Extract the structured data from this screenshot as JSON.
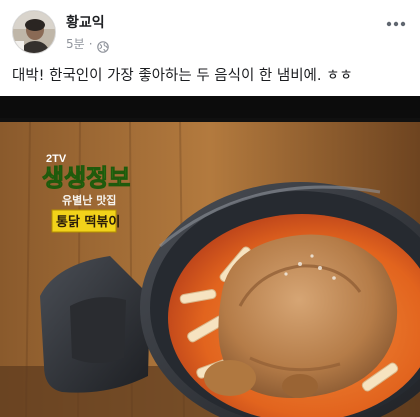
{
  "post": {
    "author": "황교익",
    "timestamp": "5분",
    "separator": "·",
    "text": "대박! 한국인이 가장 좋아하는 두 음식이 한 냄비에. ㅎㅎ"
  },
  "photo": {
    "channel": "2TV",
    "show_title": "생생정보",
    "subtitle": "유별난 맛집",
    "caption": "통닭 떡볶이"
  },
  "icons": {
    "privacy": "globe-icon",
    "menu": "more-icon"
  },
  "colors": {
    "name": "#1c1e21",
    "meta": "#90949c",
    "caption_box": "#f2d21a",
    "show_title_green": "#5bd02a"
  }
}
